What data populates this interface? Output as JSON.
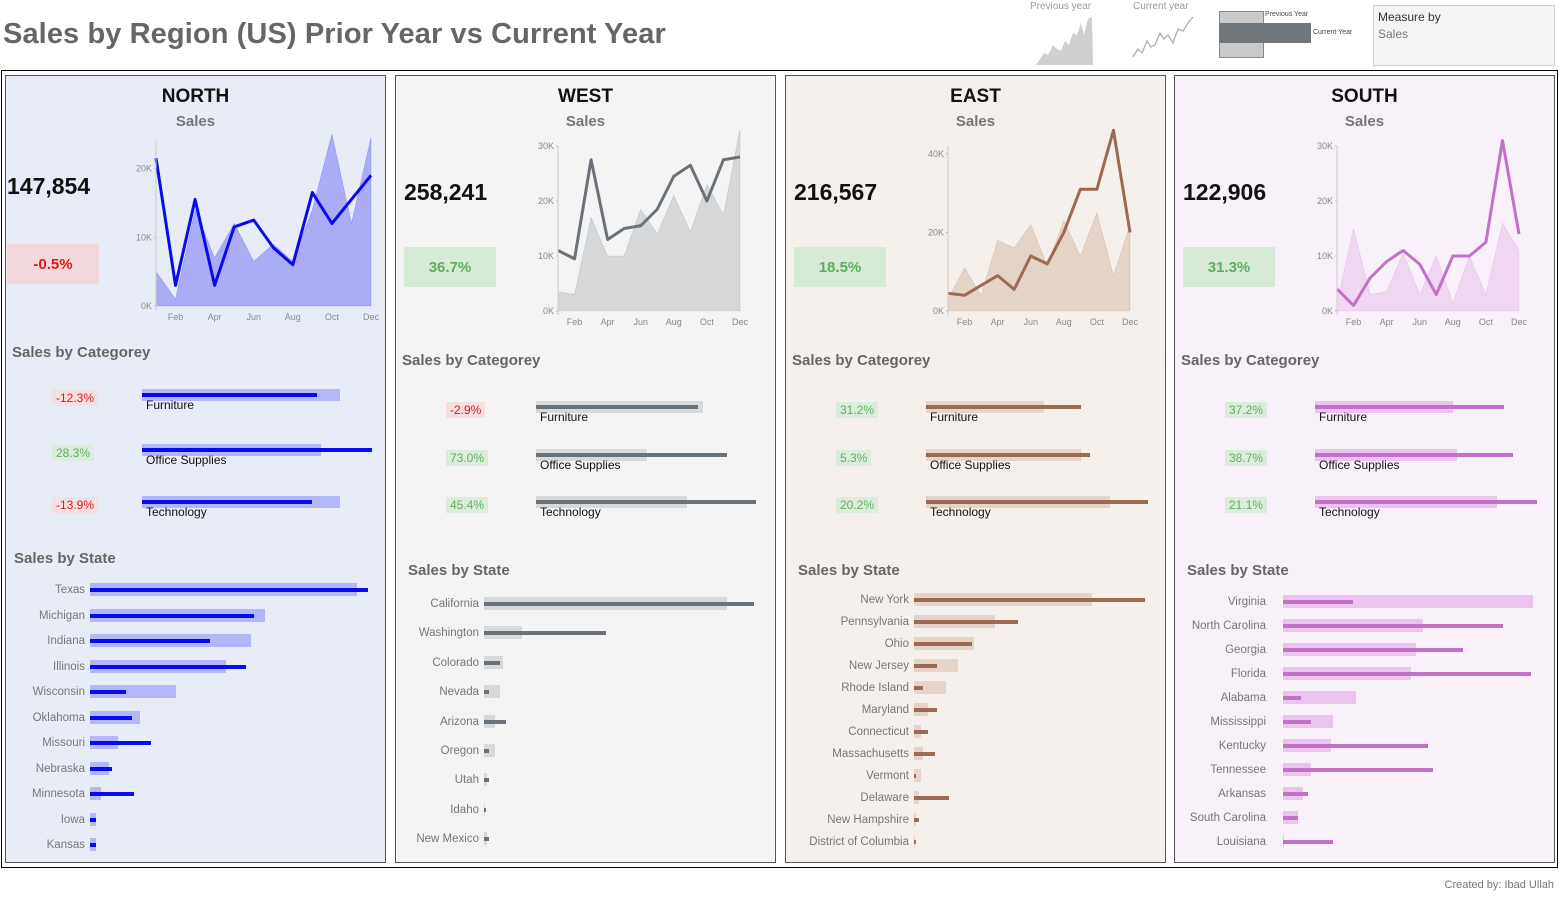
{
  "title": "Sales by Region (US) Prior Year vs Current Year",
  "legend": {
    "previous_label": "Previous year",
    "current_label": "Current year",
    "bar_prev_label": "Previous Year",
    "bar_cur_label": "Current Year"
  },
  "measure": {
    "title": "Measure by",
    "value": "Sales"
  },
  "credit": "Created by: Ibad Ullah",
  "labels": {
    "categories_title": "Sales by Categorey",
    "states_title": "Sales by State",
    "subtitle": "Sales"
  },
  "chart_data": [
    {
      "type": "line",
      "region": "NORTH",
      "bg": "#e8ecf6",
      "color": "#0a0aee",
      "light": "#b3b7f7",
      "area": "#a6aaf6",
      "kpi": "147,854",
      "pct": "-0.5%",
      "pct_negative": true,
      "yticks": [
        "0K",
        "10K",
        "20K"
      ],
      "ymax": 24000,
      "x": [
        "Jan",
        "Feb",
        "Mar",
        "Apr",
        "May",
        "Jun",
        "Jul",
        "Aug",
        "Sep",
        "Oct",
        "Nov",
        "Dec"
      ],
      "xticks": [
        "Feb",
        "Apr",
        "Jun",
        "Aug",
        "Oct",
        "Dec"
      ],
      "current": [
        21500,
        3000,
        15500,
        3000,
        11500,
        12500,
        8500,
        6000,
        16500,
        12000,
        15500,
        19000
      ],
      "previous": [
        5000,
        1000,
        14000,
        7000,
        12000,
        6500,
        9000,
        6500,
        14000,
        25000,
        12000,
        24500
      ],
      "categories": [
        {
          "name": "Furniture",
          "pct": "-12.3%",
          "neg": true,
          "prev": 0.86,
          "cur": 0.76
        },
        {
          "name": "Office Supplies",
          "pct": "28.3%",
          "neg": false,
          "prev": 0.78,
          "cur": 1.0
        },
        {
          "name": "Technology",
          "pct": "-13.9%",
          "neg": true,
          "prev": 0.86,
          "cur": 0.74
        }
      ],
      "states": [
        {
          "name": "Texas",
          "prev": 0.96,
          "cur": 1.0
        },
        {
          "name": "Michigan",
          "prev": 0.63,
          "cur": 0.59
        },
        {
          "name": "Indiana",
          "prev": 0.58,
          "cur": 0.43
        },
        {
          "name": "Illinois",
          "prev": 0.49,
          "cur": 0.56
        },
        {
          "name": "Wisconsin",
          "prev": 0.31,
          "cur": 0.13
        },
        {
          "name": "Oklahoma",
          "prev": 0.18,
          "cur": 0.15
        },
        {
          "name": "Missouri",
          "prev": 0.1,
          "cur": 0.22
        },
        {
          "name": "Nebraska",
          "prev": 0.07,
          "cur": 0.08
        },
        {
          "name": "Minnesota",
          "prev": 0.04,
          "cur": 0.16
        },
        {
          "name": "Iowa",
          "prev": 0.02,
          "cur": 0.02
        },
        {
          "name": "Kansas",
          "prev": 0.02,
          "cur": 0.02
        }
      ]
    },
    {
      "type": "line",
      "region": "WEST",
      "bg": "#f4f4f4",
      "color": "#69727a",
      "light": "#d6d8d9",
      "area": "#d2d4d5",
      "kpi": "258,241",
      "pct": "36.7%",
      "pct_negative": false,
      "yticks": [
        "0K",
        "10K",
        "20K",
        "30K"
      ],
      "ymax": 30000,
      "x": [
        "Jan",
        "Feb",
        "Mar",
        "Apr",
        "May",
        "Jun",
        "Jul",
        "Aug",
        "Sep",
        "Oct",
        "Nov",
        "Dec"
      ],
      "xticks": [
        "Feb",
        "Apr",
        "Jun",
        "Aug",
        "Oct",
        "Dec"
      ],
      "current": [
        11000,
        9500,
        27500,
        13000,
        15000,
        15500,
        18500,
        24500,
        26500,
        20000,
        27500,
        28000
      ],
      "previous": [
        3500,
        3000,
        17000,
        10000,
        10000,
        18500,
        14000,
        21000,
        14500,
        23000,
        17500,
        33000
      ],
      "categories": [
        {
          "name": "Furniture",
          "pct": "-2.9%",
          "neg": true,
          "prev": 0.75,
          "cur": 0.73
        },
        {
          "name": "Office Supplies",
          "pct": "73.0%",
          "neg": false,
          "prev": 0.5,
          "cur": 0.86
        },
        {
          "name": "Technology",
          "pct": "45.4%",
          "neg": false,
          "prev": 0.68,
          "cur": 0.99
        }
      ],
      "states": [
        {
          "name": "California",
          "prev": 0.9,
          "cur": 1.0
        },
        {
          "name": "Washington",
          "prev": 0.14,
          "cur": 0.45
        },
        {
          "name": "Colorado",
          "prev": 0.07,
          "cur": 0.06
        },
        {
          "name": "Nevada",
          "prev": 0.06,
          "cur": 0.02
        },
        {
          "name": "Arizona",
          "prev": 0.04,
          "cur": 0.08
        },
        {
          "name": "Oregon",
          "prev": 0.04,
          "cur": 0.02
        },
        {
          "name": "Utah",
          "prev": 0.01,
          "cur": 0.02
        },
        {
          "name": "Idaho",
          "prev": 0.005,
          "cur": 0.005
        },
        {
          "name": "New Mexico",
          "prev": 0.01,
          "cur": 0.02
        }
      ]
    },
    {
      "type": "line",
      "region": "EAST",
      "bg": "#f5f0ec",
      "color": "#9b6a53",
      "light": "#e6d4ca",
      "area": "#e2cfc3",
      "kpi": "216,567",
      "pct": "18.5%",
      "pct_negative": false,
      "yticks": [
        "0K",
        "20K",
        "40K"
      ],
      "ymax": 42000,
      "x": [
        "Jan",
        "Feb",
        "Mar",
        "Apr",
        "May",
        "Jun",
        "Jul",
        "Aug",
        "Sep",
        "Oct",
        "Nov",
        "Dec"
      ],
      "xticks": [
        "Feb",
        "Apr",
        "Jun",
        "Aug",
        "Oct",
        "Dec"
      ],
      "current": [
        4500,
        4000,
        6500,
        9000,
        5500,
        14000,
        12000,
        20000,
        31000,
        31000,
        46000,
        20000
      ],
      "previous": [
        3000,
        11000,
        4000,
        18000,
        16000,
        22000,
        11500,
        23000,
        14000,
        25000,
        9000,
        22000
      ],
      "categories": [
        {
          "name": "Furniture",
          "pct": "31.2%",
          "neg": false,
          "prev": 0.53,
          "cur": 0.7
        },
        {
          "name": "Office Supplies",
          "pct": "5.3%",
          "neg": false,
          "prev": 0.7,
          "cur": 0.74
        },
        {
          "name": "Technology",
          "pct": "20.2%",
          "neg": false,
          "prev": 0.83,
          "cur": 1.0
        }
      ],
      "states": [
        {
          "name": "New York",
          "prev": 0.77,
          "cur": 1.0
        },
        {
          "name": "Pennsylvania",
          "prev": 0.35,
          "cur": 0.45
        },
        {
          "name": "Ohio",
          "prev": 0.26,
          "cur": 0.25
        },
        {
          "name": "New Jersey",
          "prev": 0.19,
          "cur": 0.1
        },
        {
          "name": "Rhode Island",
          "prev": 0.14,
          "cur": 0.04
        },
        {
          "name": "Maryland",
          "prev": 0.06,
          "cur": 0.1
        },
        {
          "name": "Connecticut",
          "prev": 0.03,
          "cur": 0.06
        },
        {
          "name": "Massachusetts",
          "prev": 0.04,
          "cur": 0.09
        },
        {
          "name": "Vermont",
          "prev": 0.03,
          "cur": 0.01
        },
        {
          "name": "Delaware",
          "prev": 0.02,
          "cur": 0.15
        },
        {
          "name": "New Hampshire",
          "prev": 0.01,
          "cur": 0.02
        },
        {
          "name": "District of Columbia",
          "prev": 0.005,
          "cur": 0.005
        }
      ]
    },
    {
      "type": "line",
      "region": "SOUTH",
      "bg": "#f9f1f9",
      "color": "#c272c6",
      "light": "#eac4ec",
      "area": "#edd4ef",
      "kpi": "122,906",
      "pct": "31.3%",
      "pct_negative": false,
      "yticks": [
        "0K",
        "10K",
        "20K",
        "30K"
      ],
      "ymax": 30000,
      "x": [
        "Jan",
        "Feb",
        "Mar",
        "Apr",
        "May",
        "Jun",
        "Jul",
        "Aug",
        "Sep",
        "Oct",
        "Nov",
        "Dec"
      ],
      "xticks": [
        "Feb",
        "Apr",
        "Jun",
        "Aug",
        "Oct",
        "Dec"
      ],
      "current": [
        4000,
        1000,
        6000,
        9000,
        11000,
        8500,
        3000,
        10000,
        10000,
        12500,
        31000,
        14000
      ],
      "previous": [
        1500,
        15000,
        3000,
        3500,
        10500,
        3000,
        10000,
        1500,
        10000,
        3000,
        16000,
        11000
      ],
      "categories": [
        {
          "name": "Furniture",
          "pct": "37.2%",
          "neg": false,
          "prev": 0.62,
          "cur": 0.85
        },
        {
          "name": "Office Supplies",
          "pct": "38.7%",
          "neg": false,
          "prev": 0.64,
          "cur": 0.89
        },
        {
          "name": "Technology",
          "pct": "21.1%",
          "neg": false,
          "prev": 0.82,
          "cur": 1.0
        }
      ],
      "states": [
        {
          "name": "Virginia",
          "prev": 1.0,
          "cur": 0.28
        },
        {
          "name": "North Carolina",
          "prev": 0.56,
          "cur": 0.88
        },
        {
          "name": "Georgia",
          "prev": 0.53,
          "cur": 0.72
        },
        {
          "name": "Florida",
          "prev": 0.51,
          "cur": 0.99
        },
        {
          "name": "Alabama",
          "prev": 0.29,
          "cur": 0.07
        },
        {
          "name": "Mississippi",
          "prev": 0.2,
          "cur": 0.11
        },
        {
          "name": "Kentucky",
          "prev": 0.19,
          "cur": 0.58
        },
        {
          "name": "Tennessee",
          "prev": 0.11,
          "cur": 0.6
        },
        {
          "name": "Arkansas",
          "prev": 0.08,
          "cur": 0.1
        },
        {
          "name": "South Carolina",
          "prev": 0.06,
          "cur": 0.06
        },
        {
          "name": "Louisiana",
          "prev": 0.005,
          "cur": 0.2
        }
      ]
    }
  ]
}
